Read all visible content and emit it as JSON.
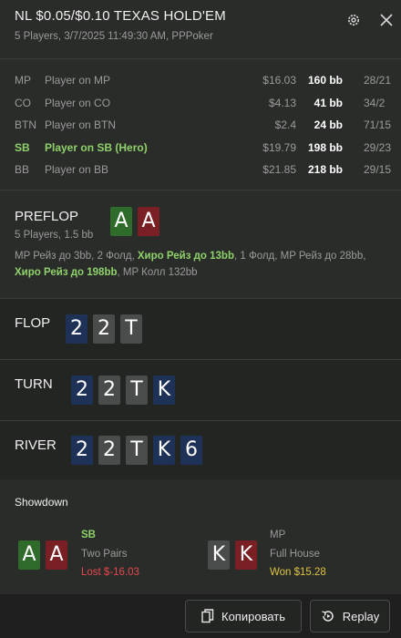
{
  "header": {
    "title": "NL $0.05/$0.10 TEXAS HOLD'EM",
    "subtitle": "5 Players, 3/7/2025 11:49:30 AM, PPPoker",
    "settings_icon": "gear-icon",
    "close_icon": "close-icon"
  },
  "players": [
    {
      "pos": "MP",
      "name": "Player on MP",
      "stack": "$16.03",
      "bb": "160 bb",
      "stat": "28/21",
      "hero": false
    },
    {
      "pos": "CO",
      "name": "Player on CO",
      "stack": "$4.13",
      "bb": "41 bb",
      "stat": "34/2",
      "hero": false
    },
    {
      "pos": "BTN",
      "name": "Player on BTN",
      "stack": "$2.4",
      "bb": "24 bb",
      "stat": "71/15",
      "hero": false
    },
    {
      "pos": "SB",
      "name": "Player on SB (Hero)",
      "stack": "$19.79",
      "bb": "198 bb",
      "stat": "29/23",
      "hero": true
    },
    {
      "pos": "BB",
      "name": "Player on BB",
      "stack": "$21.85",
      "bb": "218 bb",
      "stat": "29/15",
      "hero": false
    }
  ],
  "preflop": {
    "label": "PREFLOP",
    "sub": "5 Players, 1.5 bb",
    "hole_cards": [
      {
        "rank": "A",
        "color": "green"
      },
      {
        "rank": "A",
        "color": "red"
      }
    ],
    "actions": [
      {
        "text": "MP Рейз до 3bb, 2 Фолд, ",
        "hero": false
      },
      {
        "text": "Хиро Рейз до 13bb",
        "hero": true
      },
      {
        "text": ", 1 Фолд, MP Рейз до 28bb, ",
        "hero": false
      },
      {
        "text": "Хиро Рейз до 198bb",
        "hero": true
      },
      {
        "text": ", MP Колл 132bb",
        "hero": false
      }
    ]
  },
  "flop": {
    "label": "FLOP",
    "cards": [
      {
        "rank": "2",
        "color": "blue"
      },
      {
        "rank": "2",
        "color": "gray"
      },
      {
        "rank": "T",
        "color": "gray"
      }
    ]
  },
  "turn": {
    "label": "TURN",
    "cards": [
      {
        "rank": "2",
        "color": "blue"
      },
      {
        "rank": "2",
        "color": "gray"
      },
      {
        "rank": "T",
        "color": "gray"
      },
      {
        "rank": "K",
        "color": "blue"
      }
    ]
  },
  "river": {
    "label": "RIVER",
    "cards": [
      {
        "rank": "2",
        "color": "blue"
      },
      {
        "rank": "2",
        "color": "gray"
      },
      {
        "rank": "T",
        "color": "gray"
      },
      {
        "rank": "K",
        "color": "blue"
      },
      {
        "rank": "6",
        "color": "blue"
      }
    ]
  },
  "showdown": {
    "title": "Showdown",
    "entries": [
      {
        "pos": "SB",
        "hand": "Two Pairs",
        "result": "Lost $-16.03",
        "outcome": "lost",
        "hero": true,
        "cards": [
          {
            "rank": "A",
            "color": "green"
          },
          {
            "rank": "A",
            "color": "red"
          }
        ]
      },
      {
        "pos": "MP",
        "hand": "Full House",
        "result": "Won $15.28",
        "outcome": "won",
        "hero": false,
        "cards": [
          {
            "rank": "K",
            "color": "gray"
          },
          {
            "rank": "K",
            "color": "red"
          }
        ]
      }
    ]
  },
  "footer": {
    "copy_label": "Копировать",
    "copy_icon": "copy-icon",
    "replay_label": "Replay",
    "replay_icon": "replay-icon"
  },
  "colors": {
    "hero_green": "#8fd16a",
    "lost_red": "#e5484d",
    "won_yellow": "#e0c341",
    "card_green": "#2f6b2b",
    "card_red": "#7a1f24",
    "card_blue": "#1e3157",
    "card_gray": "#4a4b4b"
  }
}
